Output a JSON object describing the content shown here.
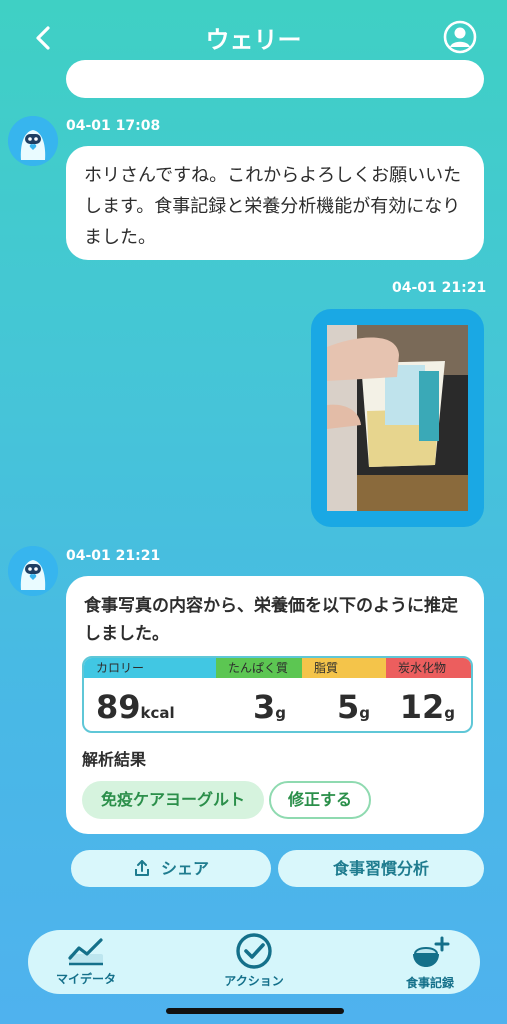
{
  "header": {
    "title": "ウェリー"
  },
  "messages": [
    {
      "timestamp": "04-01 17:08",
      "text": "ホリさんですね。これからよろしくお願いいたします。食事記録と栄養分析機能が有効になりました。"
    },
    {
      "timestamp": "04-01 21:21",
      "type": "photo"
    },
    {
      "timestamp": "04-01 21:21",
      "text": "食事写真の内容から、栄養価を以下のように推定しました。"
    }
  ],
  "nutrition": {
    "calorie": {
      "label": "カロリー",
      "value": "89",
      "unit": "kcal",
      "color": "#41c7e3"
    },
    "protein": {
      "label": "たんぱく質",
      "value": "3",
      "unit": "g",
      "color": "#5cc652"
    },
    "fat": {
      "label": "脂質",
      "value": "5",
      "unit": "g",
      "color": "#f4c44a"
    },
    "carbs": {
      "label": "炭水化物",
      "value": "12",
      "unit": "g",
      "color": "#ec5e5e"
    }
  },
  "analysis": {
    "label": "解析結果",
    "food_name": "免疫ケアヨーグルト",
    "edit_label": "修正する"
  },
  "actions": {
    "share_label": "シェア",
    "habit_label": "食事習慣分析"
  },
  "tabs": [
    {
      "label": "マイデータ",
      "icon": "chart-icon"
    },
    {
      "label": "アクション",
      "icon": "check-circle-icon"
    },
    {
      "label": "食事記録",
      "icon": "meal-add-icon"
    }
  ],
  "colors": {
    "accent": "#1aa8e4",
    "tab_text": "#14708a",
    "chip_green": "#2b8f4a"
  }
}
